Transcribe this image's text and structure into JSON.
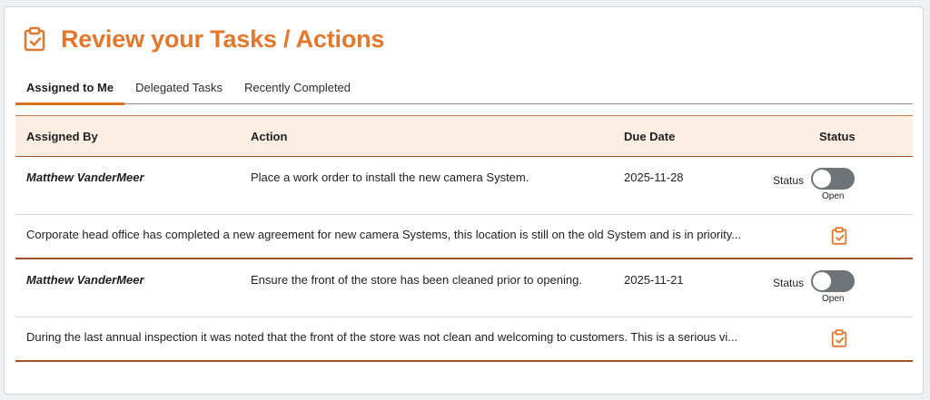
{
  "header": {
    "title": "Review your Tasks / Actions",
    "icon": "clipboard-check-icon",
    "accent": "#e3782c"
  },
  "tabs": [
    {
      "label": "Assigned to Me",
      "active": true
    },
    {
      "label": "Delegated Tasks",
      "active": false
    },
    {
      "label": "Recently Completed",
      "active": false
    }
  ],
  "table": {
    "columns": [
      "Assigned By",
      "Action",
      "Due Date",
      "Status"
    ],
    "rows": [
      {
        "assigned_by": "Matthew VanderMeer",
        "action": "Place a work order to install the new camera System.",
        "due_date": "2025-11-28",
        "status_label": "Status",
        "status_value": "Open",
        "description": "Corporate head office has completed a new agreement for new camera Systems, this location is still on the old System and is in priority..."
      },
      {
        "assigned_by": "Matthew VanderMeer",
        "action": "Ensure the front of the store has been cleaned prior to opening.",
        "due_date": "2025-11-21",
        "status_label": "Status",
        "status_value": "Open",
        "description": "During the last annual inspection it was noted that the front of the store was not clean and welcoming to customers. This is a serious vi..."
      }
    ]
  }
}
